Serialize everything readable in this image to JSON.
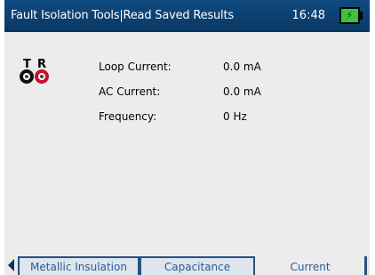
{
  "header": {
    "title": "Fault Isolation Tools|Read Saved Results",
    "time": "16:48",
    "battery_icon": "battery-charging-icon"
  },
  "probe": {
    "t_label": "T",
    "r_label": "R"
  },
  "measurements": [
    {
      "label": "Loop Current:",
      "value": "0.0 mA"
    },
    {
      "label": "AC Current:",
      "value": "0.0 mA"
    },
    {
      "label": "Frequency:",
      "value": "0 Hz"
    }
  ],
  "tabs": [
    {
      "label": "Metallic Insulation",
      "active": false
    },
    {
      "label": "Capacitance",
      "active": false
    },
    {
      "label": "Current",
      "active": true
    }
  ],
  "colors": {
    "titlebar": "#0a3764",
    "accent": "#2a5c93",
    "probe_t": "#111111",
    "probe_r": "#c8102e",
    "battery": "#3fc23f"
  }
}
